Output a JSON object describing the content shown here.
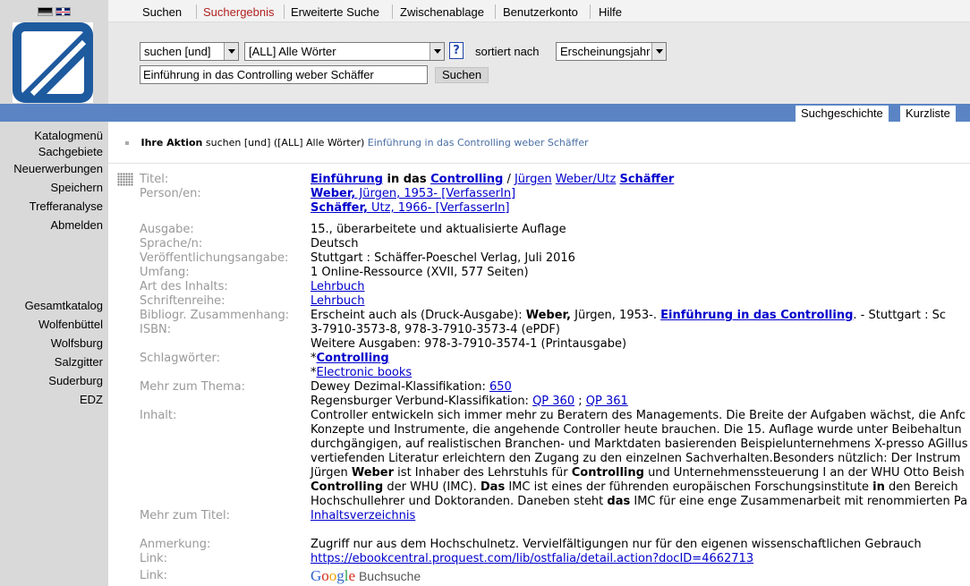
{
  "nav": {
    "tabs": [
      "Suchen",
      "Suchergebnis",
      "Erweiterte Suche",
      "Zwischenablage",
      "Benutzerkonto",
      "Hilfe"
    ]
  },
  "search": {
    "operator": "suchen [und]",
    "field": "[ALL] Alle Wörter",
    "help": "?",
    "sort_label": "sortiert nach",
    "sort_value": "Erscheinungsjahr",
    "query": "Einführung in das Controlling weber Schäffer",
    "button": "Suchen"
  },
  "band_tabs": [
    "Suchgeschichte",
    "Kurzliste"
  ],
  "left_nav": {
    "group1": [
      "Katalogmenü",
      "Sachgebiete",
      "Neuerwerbungen",
      "Speichern",
      "Trefferanalyse",
      "Abmelden"
    ],
    "group2": [
      "Gesamtkatalog",
      "Wolfenbüttel",
      "Wolfsburg",
      "Salzgitter",
      "Suderburg",
      "EDZ"
    ]
  },
  "action": {
    "label": "Ihre Aktion",
    "mode": "suchen [und] ([ALL] Alle Wörter)",
    "query": "Einführung in das Controlling weber Schäffer"
  },
  "record": {
    "labels": {
      "titel": "Titel:",
      "person": "Person/en:",
      "ausgabe": "Ausgabe:",
      "sprache": "Sprache/n:",
      "veroeff": "Veröffentlichungsangabe:",
      "umfang": "Umfang:",
      "art": "Art des Inhalts:",
      "reihe": "Schriftenreihe:",
      "biblio": "Bibliogr. Zusammenhang:",
      "isbn": "ISBN:",
      "schlag": "Schlagwörter:",
      "thema": "Mehr zum Thema:",
      "inhalt": "Inhalt:",
      "mehrtitel": "Mehr zum Titel:",
      "anmerkung": "Anmerkung:",
      "link1": "Link:",
      "link2": "Link:"
    },
    "title": {
      "w1": "Einführung",
      "w2": " in das ",
      "w3": "Controlling",
      "w4": " / ",
      "w5": "Jürgen",
      "w6": " ",
      "w7": "Weber/Utz",
      "w8": " ",
      "w9": "Schäffer"
    },
    "person1": {
      "name": "Weber,",
      "rest": " Jürgen, 1953- [VerfasserIn]"
    },
    "person2": {
      "name": "Schäffer,",
      "rest": " Utz, 1966- [VerfasserIn]"
    },
    "ausgabe": "15., überarbeitete und aktualisierte Auflage",
    "sprache": "Deutsch",
    "veroeff": "Stuttgart : Schäffer-Poeschel Verlag, Juli 2016",
    "umfang": "1 Online-Ressource (XVII, 577 Seiten)",
    "art": "Lehrbuch",
    "reihe": "Lehrbuch",
    "biblio": {
      "a": "Erscheint auch als (Druck-Ausgabe): ",
      "b": "Weber,",
      "c": " Jürgen, 1953-. ",
      "d": "Einführung in das Controlling",
      "e": ". - Stuttgart : Sc"
    },
    "isbn1": "3-7910-3573-8, 978-3-7910-3573-4 (ePDF)",
    "isbn2": "Weitere Ausgaben: 978-3-7910-3574-1 (Printausgabe)",
    "schlag1_prefix": "*",
    "schlag1": "Controlling",
    "schlag2_prefix": "*",
    "schlag2": "Electronic books",
    "thema1": {
      "text": "Dewey Dezimal-Klassifikation: ",
      "link": "650"
    },
    "thema2": {
      "text": "Regensburger Verbund-Klassifikation: ",
      "l1": "QP 360",
      "sep": " ; ",
      "l2": "QP 361"
    },
    "inhalt": {
      "l1": "Controller entwickeln sich immer mehr zu Beratern des Managements. Die Breite der Aufgaben wächst, die Anfc",
      "l2": "Konzepte und Instrumente, die angehende Controller heute brauchen. Die 15. Auflage wurde unter Beibehaltun",
      "l3": "durchgängigen, auf realistischen Branchen- und Marktdaten basierenden Beispielunternehmens X-presso AGillus",
      "l4": "vertiefenden Literatur erleichtern den Zugang zu den einzelnen Sachverhalten.Besonders nützlich: Der Instrum",
      "l5a": "Jürgen ",
      "l5b": "Weber",
      "l5c": " ist Inhaber des Lehrstuhls für ",
      "l5d": "Controlling",
      "l5e": " und Unternehmenssteuerung I an der WHU Otto Beish",
      "l6a": "Controlling",
      "l6b": " der WHU (IMC). ",
      "l6c": "Das",
      "l6d": " IMC ist eines der führenden europäischen Forschungsinstitute ",
      "l6e": "in",
      "l6f": " den Bereich",
      "l7a": "Hochschullehrer und Doktoranden. Daneben steht ",
      "l7b": "das",
      "l7c": " IMC für eine enge Zusammenarbeit mit renommierten Pa"
    },
    "mehrtitel": "Inhaltsverzeichnis",
    "anmerkung": "Zugriff nur aus dem Hochschulnetz. Vervielfältigungen nur für den eigenen wissenschaftlichen Gebrauch",
    "link1": "https://ebookcentral.proquest.com/lib/ostfalia/detail.action?docID=4662713",
    "google": {
      "g1": "G",
      "g2": "o",
      "g3": "o",
      "g4": "g",
      "g5": "l",
      "g6": "e",
      "suffix": " Buchsuche"
    }
  },
  "colors": {
    "band": "#5a84c4",
    "logo": "#1e5a9e",
    "active_tab": "#b22222",
    "link": "#0000cc"
  }
}
